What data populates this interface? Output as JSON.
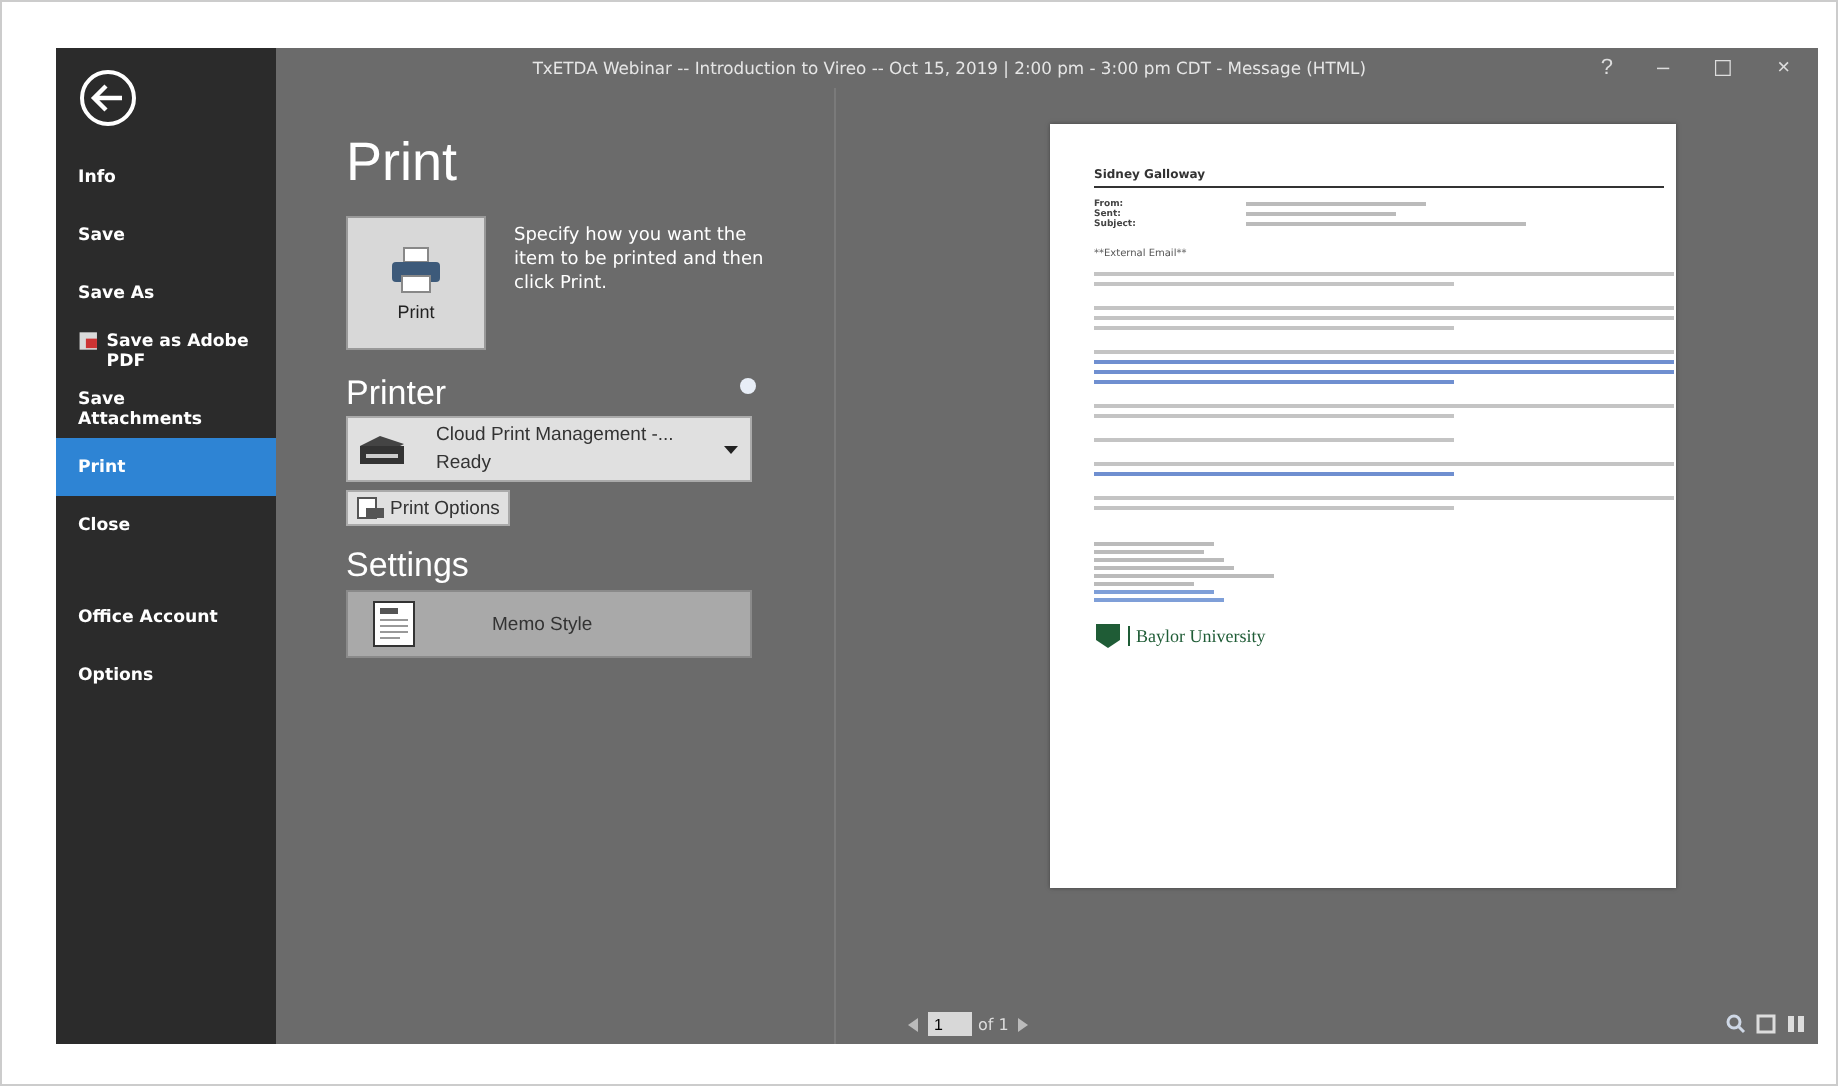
{
  "window": {
    "title": "TxETDA Webinar -- Introduction to Vireo -- Oct 15, 2019 | 2:00 pm - 3:00 pm CDT - Message (HTML)",
    "controls": [
      "?",
      "–",
      "☐",
      "×"
    ]
  },
  "sidebar": {
    "items": [
      {
        "label": "Info",
        "selected": false
      },
      {
        "label": "Save",
        "selected": false
      },
      {
        "label": "Save As",
        "selected": false
      },
      {
        "label": "Save as Adobe PDF",
        "selected": false,
        "kind": "icon"
      },
      {
        "label": "Save Attachments",
        "selected": false
      },
      {
        "label": "Print",
        "selected": true
      },
      {
        "label": "Close",
        "selected": false
      },
      {
        "label": "Office Account",
        "selected": false,
        "kind": "gap"
      },
      {
        "label": "Options",
        "selected": false
      }
    ]
  },
  "print": {
    "heading": "Print",
    "button": "Print",
    "description": "Specify how you want the item to be printed and then click Print.",
    "printer": {
      "heading": "Printer",
      "name": "Cloud Print Management -...",
      "status": "Ready",
      "options_button": "Print Options"
    },
    "settings": {
      "heading": "Settings",
      "style": "Memo Style"
    }
  },
  "preview": {
    "sender": "Sidney Galloway",
    "header_labels": [
      "From:",
      "Sent:",
      "Subject:"
    ],
    "notice": "**External Email**",
    "logo": "Baylor University",
    "pager": {
      "current": "1",
      "total": "of 1"
    }
  }
}
